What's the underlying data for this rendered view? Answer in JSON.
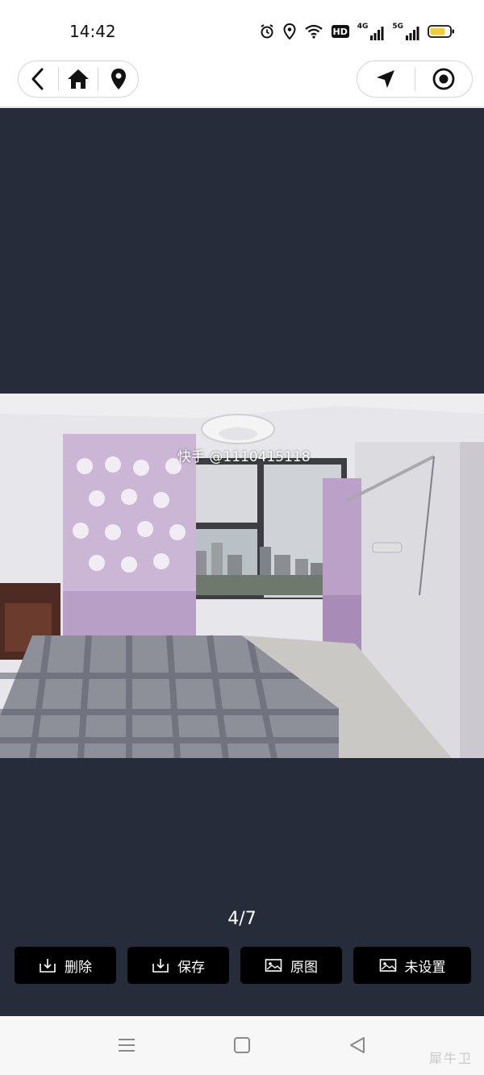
{
  "status_bar": {
    "time": "14:42",
    "hd_label": "HD",
    "network_1": "4G",
    "network_2": "5G",
    "battery_color": "#f2cc3a"
  },
  "nav": {
    "back_icon": "chevron-left-icon",
    "home_icon": "home-icon",
    "location_icon": "map-pin-icon",
    "navigate_icon": "navigation-arrow-icon",
    "target_icon": "target-icon"
  },
  "viewer": {
    "background": "#262c3a",
    "watermark": "快手 @1110415118",
    "page_counter": "4/7",
    "photo_description_icon": "bedroom-photo"
  },
  "actions": [
    {
      "label": "删除",
      "icon": "download-icon"
    },
    {
      "label": "保存",
      "icon": "download-icon"
    },
    {
      "label": "原图",
      "icon": "image-icon"
    },
    {
      "label": "未设置",
      "icon": "image-icon"
    }
  ],
  "system_nav": {
    "menu_icon": "menu-icon",
    "home_icon": "square-icon",
    "back_icon": "triangle-back-icon",
    "corner_mark": "犀牛卫"
  }
}
